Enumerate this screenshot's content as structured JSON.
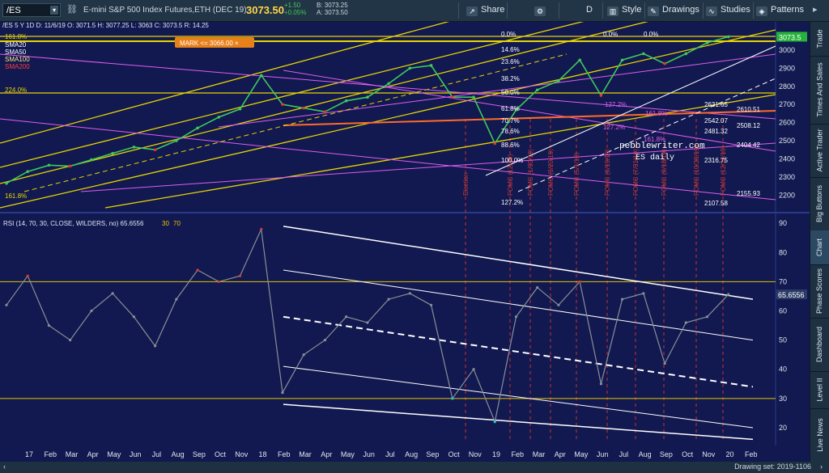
{
  "toolbar": {
    "symbol": "/ES",
    "instrument_title": "E-mini S&P 500 Index Futures,ETH (DEC 19)",
    "last_price": "3073.50",
    "change": "+1.50",
    "change_pct": "+0.05%",
    "bid": "B: 3073.25",
    "ask": "A: 3073.50",
    "interval": "D",
    "buttons": {
      "share": "Share",
      "style": "Style",
      "drawings": "Drawings",
      "studies": "Studies",
      "patterns": "Patterns"
    }
  },
  "price_info": "/ES 5 Y 1D  D: 11/6/19  O: 3071.5  H: 3077.25  L: 3063  C: 3073.5  R: 14.25",
  "moving_averages": [
    "SMA20",
    "SMA50",
    "SMA100",
    "SMA200"
  ],
  "fib_left_labels": [
    "161.8%",
    "224.0%",
    "161.8%"
  ],
  "mark_label": "MARK <= 3066.00 ×",
  "fib_center_labels": [
    "0.0%",
    "14.6%",
    "23.6%",
    "38.2%",
    "50.0%",
    "61.8%",
    "70.7%",
    "78.6%",
    "88.6%",
    "100.0%",
    "127.2%"
  ],
  "fib_right_labels": [
    "0.0%",
    "0.0%",
    "127.2%",
    "161.8%",
    "127.2%",
    "161.8%"
  ],
  "price_level_labels": [
    "2631.65",
    "2610.51",
    "2542.07",
    "2508.12",
    "2481.32",
    "2404.42",
    "2316.75",
    "2155.93",
    "2107.58"
  ],
  "watermark": [
    "pebblewriter.com",
    "ES daily"
  ],
  "fomc_labels": [
    "Election",
    "FOMC (12/19)",
    "FOMC (1/30/19)",
    "FOMC (3/20/19)",
    "FOMC (5/1/19)",
    "FOMC (6/19/19)",
    "FOMC (7/31/19)",
    "FOMC (9/18/19)",
    "FOMC (10/30/19)",
    "FOMC (12/11/19)"
  ],
  "x_axis_labels": [
    "17",
    "Feb",
    "Mar",
    "Apr",
    "May",
    "Jun",
    "Jul",
    "Aug",
    "Sep",
    "Oct",
    "Nov",
    "18",
    "Feb",
    "Mar",
    "Apr",
    "May",
    "Jun",
    "Jul",
    "Aug",
    "Sep",
    "Oct",
    "Nov",
    "19",
    "Feb",
    "Mar",
    "Apr",
    "May",
    "Jun",
    "Jul",
    "Aug",
    "Sep",
    "Oct",
    "Nov",
    "20",
    "Feb"
  ],
  "rsi_label": "RSI (14, 70, 30, CLOSE, WILDERS, no)",
  "rsi_value": "65.6556",
  "rsi_levels": [
    "30",
    "70"
  ],
  "rsi_axis_labels": [
    "90",
    "80",
    "70",
    "60",
    "50",
    "40",
    "30",
    "20"
  ],
  "rsi_current_value_box": "65.6556",
  "right_tabs": [
    "Trade",
    "Times And Sales",
    "Active Trader",
    "Big Buttons",
    "Chart",
    "Phase Scores",
    "Dashboard",
    "Level II",
    "Live News"
  ],
  "footer": "Drawing set: 2019-1106",
  "colors": {
    "background": "#111950",
    "price_up": "#3ec95a",
    "price_down": "#e03a2b",
    "fib_yellow": "#e8d400",
    "channel_magenta": "#e05cf0",
    "rsi_line": "#8a8f96",
    "accent_last": "#ffd54a"
  },
  "chart_data": [
    {
      "type": "line",
      "title": "/ES 5 Y 1D",
      "xlabel": "",
      "ylabel": "",
      "y_axis_labels": [
        "3073.5",
        "3000",
        "2900",
        "2800",
        "2700",
        "2600",
        "2500",
        "2400",
        "2300",
        "2200"
      ],
      "ylim": [
        2130,
        3120
      ],
      "series": [
        {
          "name": "/ES",
          "x": [
            "Jan 17",
            "Feb 17",
            "Mar 17",
            "Apr 17",
            "May 17",
            "Jun 17",
            "Jul 17",
            "Aug 17",
            "Sep 17",
            "Oct 17",
            "Nov 17",
            "Dec 17",
            "Jan 18",
            "Feb 18",
            "Mar 18",
            "Apr 18",
            "May 18",
            "Jun 18",
            "Jul 18",
            "Aug 18",
            "Sep 18",
            "Oct 18",
            "Nov 18",
            "Dec 18",
            "Jan 19",
            "Feb 19",
            "Mar 19",
            "Apr 19",
            "May 19",
            "Jun 19",
            "Jul 19",
            "Aug 19",
            "Sep 19",
            "Oct 19",
            "Nov 19"
          ],
          "values": [
            2265,
            2330,
            2365,
            2360,
            2395,
            2430,
            2465,
            2450,
            2500,
            2570,
            2630,
            2675,
            2860,
            2700,
            2680,
            2660,
            2720,
            2740,
            2815,
            2900,
            2915,
            2740,
            2740,
            2485,
            2670,
            2780,
            2830,
            2945,
            2750,
            2945,
            2980,
            2925,
            2980,
            3040,
            3073.5
          ]
        }
      ],
      "price_tags": [
        "3073.5",
        "3000.00",
        "2900.00"
      ]
    },
    {
      "type": "line",
      "title": "RSI (14, 70, 30, CLOSE, WILDERS, no)",
      "ylim": [
        15,
        92
      ],
      "y_axis_labels": [
        "90",
        "80",
        "70",
        "60",
        "50",
        "40",
        "30",
        "20"
      ],
      "levels": [
        30,
        70
      ],
      "series": [
        {
          "name": "RSI",
          "x": [
            "Jan 17",
            "Feb 17",
            "Mar 17",
            "Apr 17",
            "May 17",
            "Jun 17",
            "Jul 17",
            "Aug 17",
            "Sep 17",
            "Oct 17",
            "Nov 17",
            "Dec 17",
            "Jan 18",
            "Feb 18",
            "Mar 18",
            "Apr 18",
            "May 18",
            "Jun 18",
            "Jul 18",
            "Aug 18",
            "Sep 18",
            "Oct 18",
            "Nov 18",
            "Dec 18",
            "Jan 19",
            "Feb 19",
            "Mar 19",
            "Apr 19",
            "May 19",
            "Jun 19",
            "Jul 19",
            "Aug 19",
            "Sep 19",
            "Oct 19",
            "Nov 19"
          ],
          "values": [
            62,
            72,
            55,
            50,
            60,
            66,
            58,
            48,
            64,
            74,
            70,
            72,
            88,
            32,
            45,
            50,
            58,
            56,
            64,
            66,
            62,
            30,
            40,
            22,
            58,
            68,
            62,
            70,
            35,
            64,
            66,
            42,
            56,
            58,
            65.66
          ]
        }
      ]
    }
  ]
}
